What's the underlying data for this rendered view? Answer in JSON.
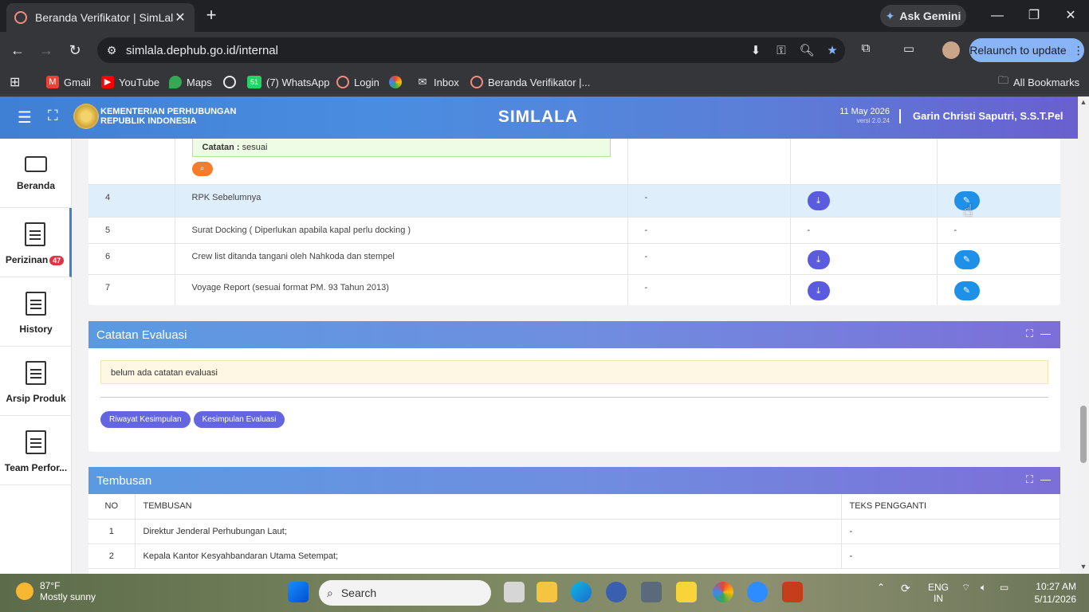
{
  "browser": {
    "tab_title": "Beranda Verifikator | SimLala",
    "url": "simlala.dephub.go.id/internal",
    "ask_gemini": "Ask Gemini",
    "relaunch": "Relaunch to update",
    "bookmarks": [
      "Gmail",
      "YouTube",
      "Maps",
      "(7) WhatsApp",
      "Login",
      "Inbox",
      "Beranda Verifikator |..."
    ],
    "whatsapp_badge": "51",
    "all_bookmarks": "All Bookmarks"
  },
  "header": {
    "org_line1": "KEMENTERIAN PERHUBUNGAN",
    "org_line2": "REPUBLIK INDONESIA",
    "app_name": "SIMLALA",
    "date": "11 May 2026",
    "version": "versi 2.0.24",
    "user": "Garin Christi Saputri, S.S.T.Pel"
  },
  "sidebar": {
    "items": [
      {
        "label": "Beranda"
      },
      {
        "label": "Perizinan",
        "badge": "47"
      },
      {
        "label": "History"
      },
      {
        "label": "Arsip Produk"
      },
      {
        "label": "Team Perfor..."
      }
    ]
  },
  "documents": {
    "catatan_label": "Catatan :",
    "catatan_value": "sesuai",
    "rows": [
      {
        "no": "4",
        "name": "RPK Sebelumnya",
        "ket": "-",
        "dl": true,
        "ed": true
      },
      {
        "no": "5",
        "name": "Surat Docking ( Diperlukan apabila kapal perlu docking )",
        "ket": "-",
        "dl_text": "-",
        "ed_text": "-"
      },
      {
        "no": "6",
        "name": "Crew list ditanda tangani oleh Nahkoda dan stempel",
        "ket": "-",
        "dl": true,
        "ed": true
      },
      {
        "no": "7",
        "name": "Voyage Report (sesuai format PM. 93 Tahun 2013)",
        "ket": "-",
        "dl": true,
        "ed": true
      }
    ]
  },
  "evaluasi": {
    "title": "Catatan Evaluasi",
    "note": "belum ada catatan evaluasi",
    "btn_riwayat": "Riwayat Kesimpulan",
    "btn_kesimpulan": "Kesimpulan Evaluasi"
  },
  "tembusan": {
    "title": "Tembusan",
    "headers": [
      "NO",
      "TEMBUSAN",
      "TEKS PENGGANTI"
    ],
    "rows": [
      {
        "no": "1",
        "name": "Direktur Jenderal Perhubungan Laut;",
        "teks": "-"
      },
      {
        "no": "2",
        "name": "Kepala Kantor Kesyahbandaran Utama Setempat;",
        "teks": "-"
      }
    ]
  },
  "taskbar": {
    "temp": "87°F",
    "weather": "Mostly sunny",
    "search": "Search",
    "lang1": "ENG",
    "lang2": "IN",
    "time": "10:27 AM",
    "date": "5/11/2026"
  },
  "colors": {
    "header_start": "#3f7fd4",
    "header_end": "#6a5fd0",
    "btn_download": "#5b5be0",
    "btn_edit": "#1e90e8"
  }
}
